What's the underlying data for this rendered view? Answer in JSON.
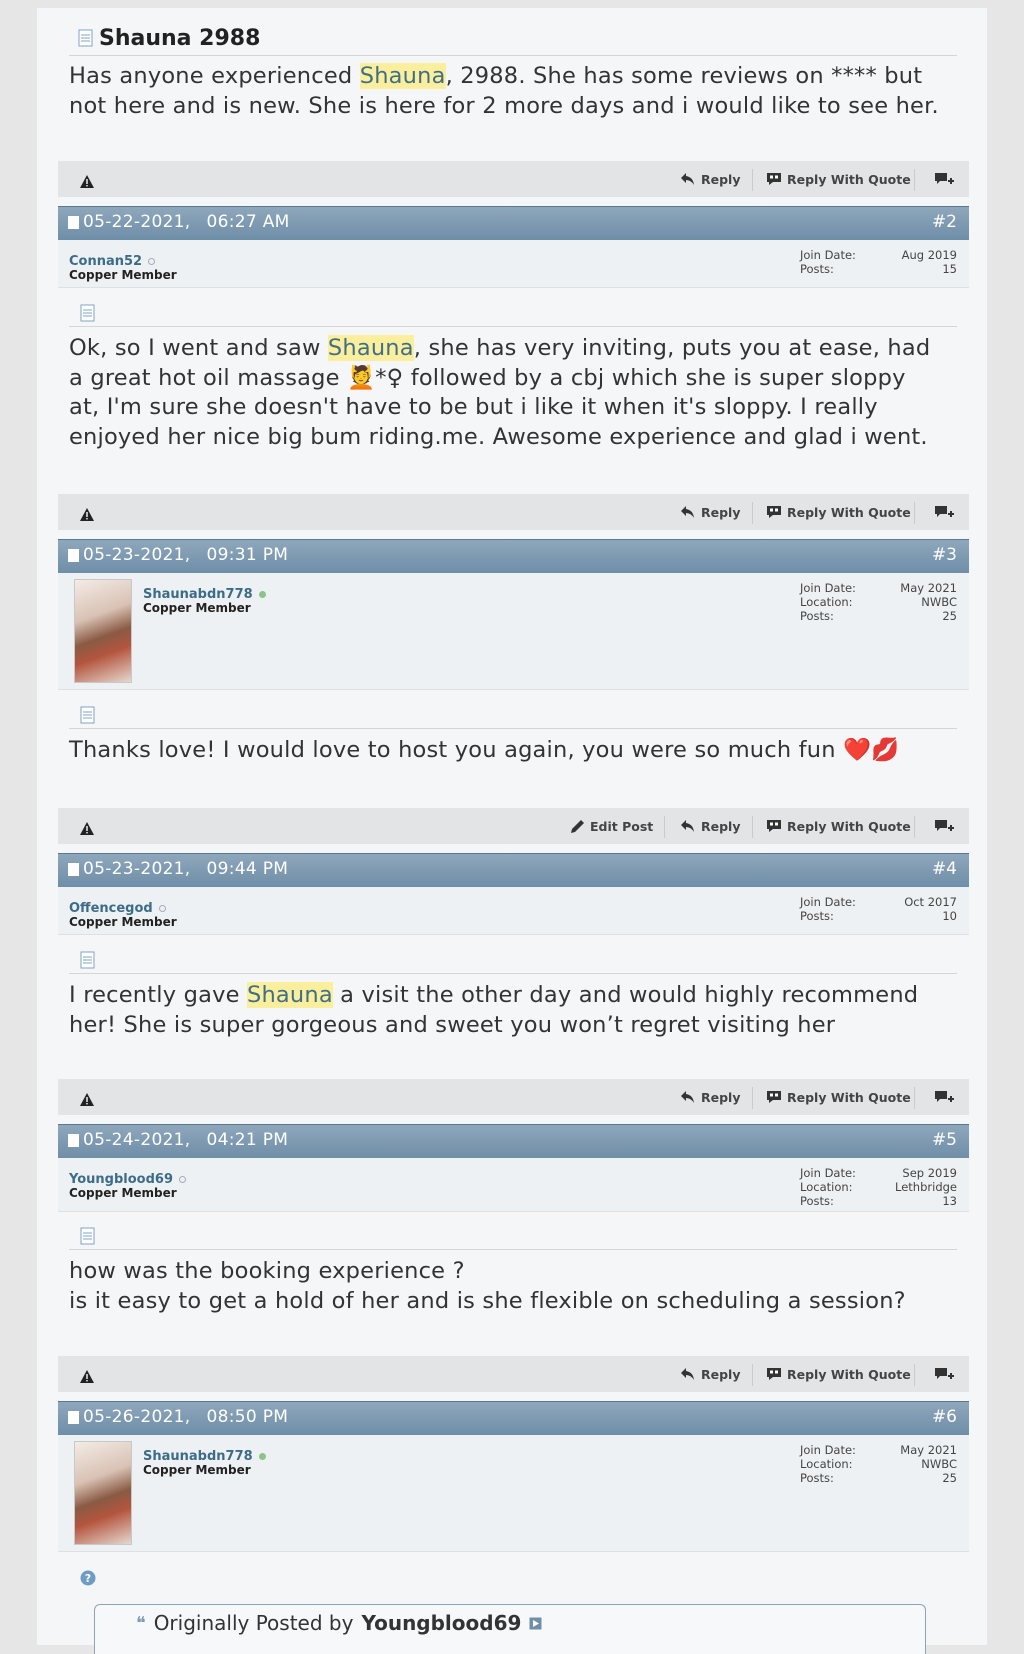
{
  "thread_title": "Shauna 2988",
  "highlight_term": "Shauna",
  "posts": [
    {
      "message_parts": [
        "Has anyone experienced ",
        "Shauna",
        ", 2988. She has some reviews on **** but",
        "not here and is new. She is here for 2 more days and i would like to see her."
      ]
    },
    {
      "date": "05-22-2021,",
      "time": "06:27 AM",
      "number": "#2",
      "username": "Connan52",
      "user_title": "Copper Member",
      "meta_labels": [
        "Join Date:",
        "Posts:"
      ],
      "meta_values": [
        "Aug 2019",
        "15"
      ],
      "message_parts": [
        "Ok, so I went and saw ",
        "Shauna",
        ", she has very inviting, puts you at ease, had",
        "a great hot oil massage 💆*♀ followed by a cbj which she is super sloppy",
        "at, I'm sure she doesn't have to be but i like it when it's sloppy. I really",
        "enjoyed her nice big bum riding.me. Awesome experience and glad i went."
      ]
    },
    {
      "date": "05-23-2021,",
      "time": "09:31 PM",
      "number": "#3",
      "username": "Shaunabdn778",
      "user_title": "Copper Member",
      "meta_labels": [
        "Join Date:",
        "Location:",
        "Posts:"
      ],
      "meta_values": [
        "May 2021",
        "NWBC",
        "25"
      ],
      "message_parts": [
        "Thanks love! I would love to host you again, you were so much fun ❤️💋"
      ]
    },
    {
      "date": "05-23-2021,",
      "time": "09:44 PM",
      "number": "#4",
      "username": "Offencegod",
      "user_title": "Copper Member",
      "meta_labels": [
        "Join Date:",
        "Posts:"
      ],
      "meta_values": [
        "Oct 2017",
        "10"
      ],
      "message_parts": [
        "I recently gave ",
        "Shauna",
        " a visit the other day and would highly recommend",
        "her! She is super gorgeous and sweet you won’t regret visiting her"
      ]
    },
    {
      "date": "05-24-2021,",
      "time": "04:21 PM",
      "number": "#5",
      "username": "Youngblood69",
      "user_title": "Copper Member",
      "meta_labels": [
        "Join Date:",
        "Location:",
        "Posts:"
      ],
      "meta_values": [
        "Sep 2019",
        "Lethbridge",
        "13"
      ],
      "message_parts": [
        "how was the booking experience ?",
        "is it easy to get a hold of her and is she flexible on scheduling a session?"
      ]
    },
    {
      "date": "05-26-2021,",
      "time": "08:50 PM",
      "number": "#6",
      "username": "Shaunabdn778",
      "user_title": "Copper Member",
      "meta_labels": [
        "Join Date:",
        "Location:",
        "Posts:"
      ],
      "meta_values": [
        "May 2021",
        "NWBC",
        "25"
      ],
      "quote_prefix": "Originally Posted by",
      "quote_author": "Youngblood69"
    }
  ],
  "actions": {
    "reply": "Reply",
    "reply_with_quote": "Reply With Quote",
    "edit_post": "Edit Post"
  },
  "colors": {
    "header_bar": "#7f9ab1",
    "highlight": "#fbef9e",
    "username": "#3c6c87"
  }
}
